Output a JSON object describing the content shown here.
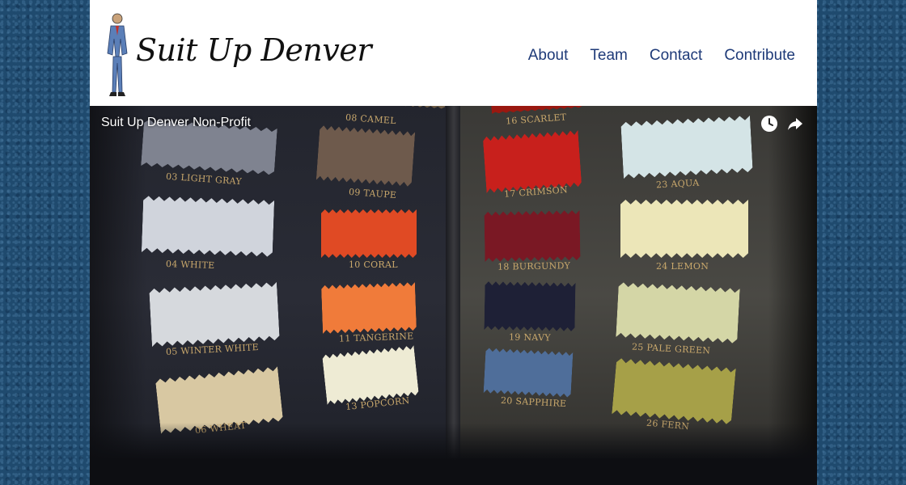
{
  "header": {
    "brand": "Suit Up Denver",
    "nav": [
      {
        "label": "About"
      },
      {
        "label": "Team"
      },
      {
        "label": "Contact"
      },
      {
        "label": "Contribute"
      }
    ]
  },
  "video": {
    "title": "Suit Up Denver Non-Profit",
    "icons": [
      "watch-later-icon",
      "share-icon"
    ],
    "swatches": [
      {
        "label": "08 CAMEL",
        "color": "#6b5a44"
      },
      {
        "label": "03 LIGHT GRAY",
        "color": "#7f8390"
      },
      {
        "label": "09 TAUPE",
        "color": "#6e5a4c"
      },
      {
        "label": "04 WHITE",
        "color": "#d0d4dc"
      },
      {
        "label": "10 CORAL",
        "color": "#e04a24"
      },
      {
        "label": "05 WINTER WHITE",
        "color": "#d6d9dd"
      },
      {
        "label": "11 TANGERINE",
        "color": "#f07b3a"
      },
      {
        "label": "06 WHEAT",
        "color": "#d8c8a2"
      },
      {
        "label": "13 POPCORN",
        "color": "#eeebd4"
      },
      {
        "label": "16 SCARLET",
        "color": "#9a1810"
      },
      {
        "label": "17 CRIMSON",
        "color": "#c8201c"
      },
      {
        "label": "23 AQUA",
        "color": "#d4e4e6"
      },
      {
        "label": "18 BURGUNDY",
        "color": "#7a1824"
      },
      {
        "label": "24 LEMON",
        "color": "#ece6b8"
      },
      {
        "label": "19 NAVY",
        "color": "#1e2036"
      },
      {
        "label": "25 PALE GREEN",
        "color": "#d4d6a6"
      },
      {
        "label": "20 SAPPHIRE",
        "color": "#4f6e9a"
      },
      {
        "label": "26 FERN",
        "color": "#a6a048"
      }
    ]
  }
}
